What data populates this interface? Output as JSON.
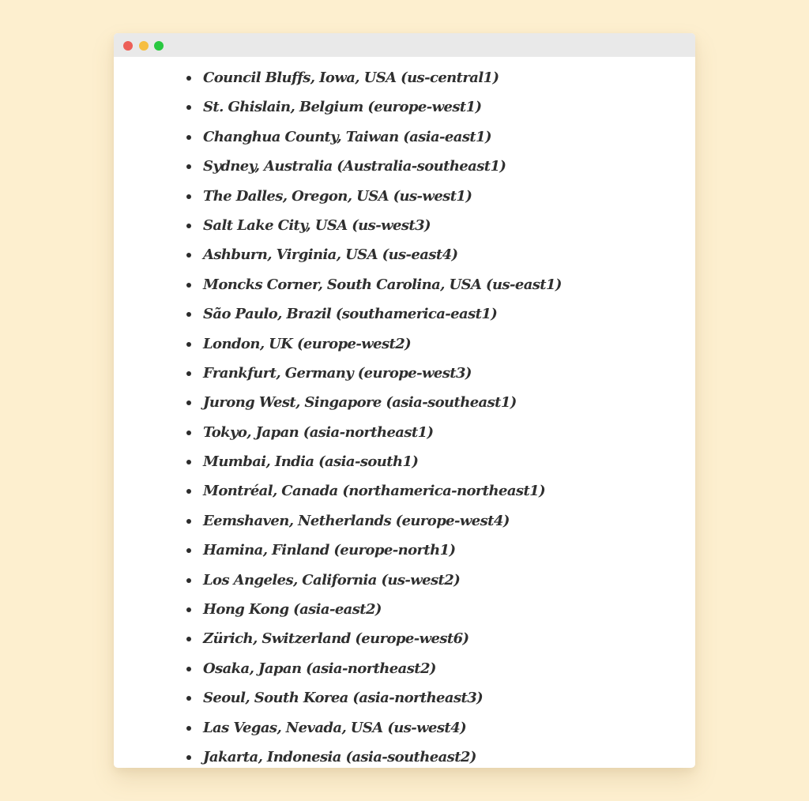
{
  "window": {
    "controls": [
      {
        "name": "close",
        "color": "#ed5f57"
      },
      {
        "name": "minimize",
        "color": "#f6be41"
      },
      {
        "name": "maximize",
        "color": "#29c840"
      }
    ]
  },
  "regions": [
    "Council Bluffs, Iowa, USA (us-central1)",
    "St. Ghislain, Belgium (europe-west1)",
    "Changhua County, Taiwan (asia-east1)",
    "Sydney, Australia (Australia-southeast1)",
    "The Dalles, Oregon, USA (us-west1)",
    "Salt Lake City, USA (us-west3)",
    "Ashburn, Virginia, USA (us-east4)",
    "Moncks Corner, South Carolina, USA (us-east1)",
    "São Paulo, Brazil (southamerica-east1)",
    "London, UK (europe-west2)",
    "Frankfurt, Germany (europe-west3)",
    "Jurong West, Singapore (asia-southeast1)",
    "Tokyo, Japan (asia-northeast1)",
    "Mumbai, India (asia-south1)",
    "Montréal, Canada (northamerica-northeast1)",
    "Eemshaven, Netherlands (europe-west4)",
    "Hamina, Finland (europe-north1)",
    "Los Angeles, California (us-west2)",
    "Hong Kong (asia-east2)",
    "Zürich, Switzerland (europe-west6)",
    "Osaka, Japan (asia-northeast2)",
    "Seoul, South Korea (asia-northeast3)",
    "Las Vegas, Nevada, USA (us-west4)",
    "Jakarta, Indonesia (asia-southeast2)"
  ]
}
